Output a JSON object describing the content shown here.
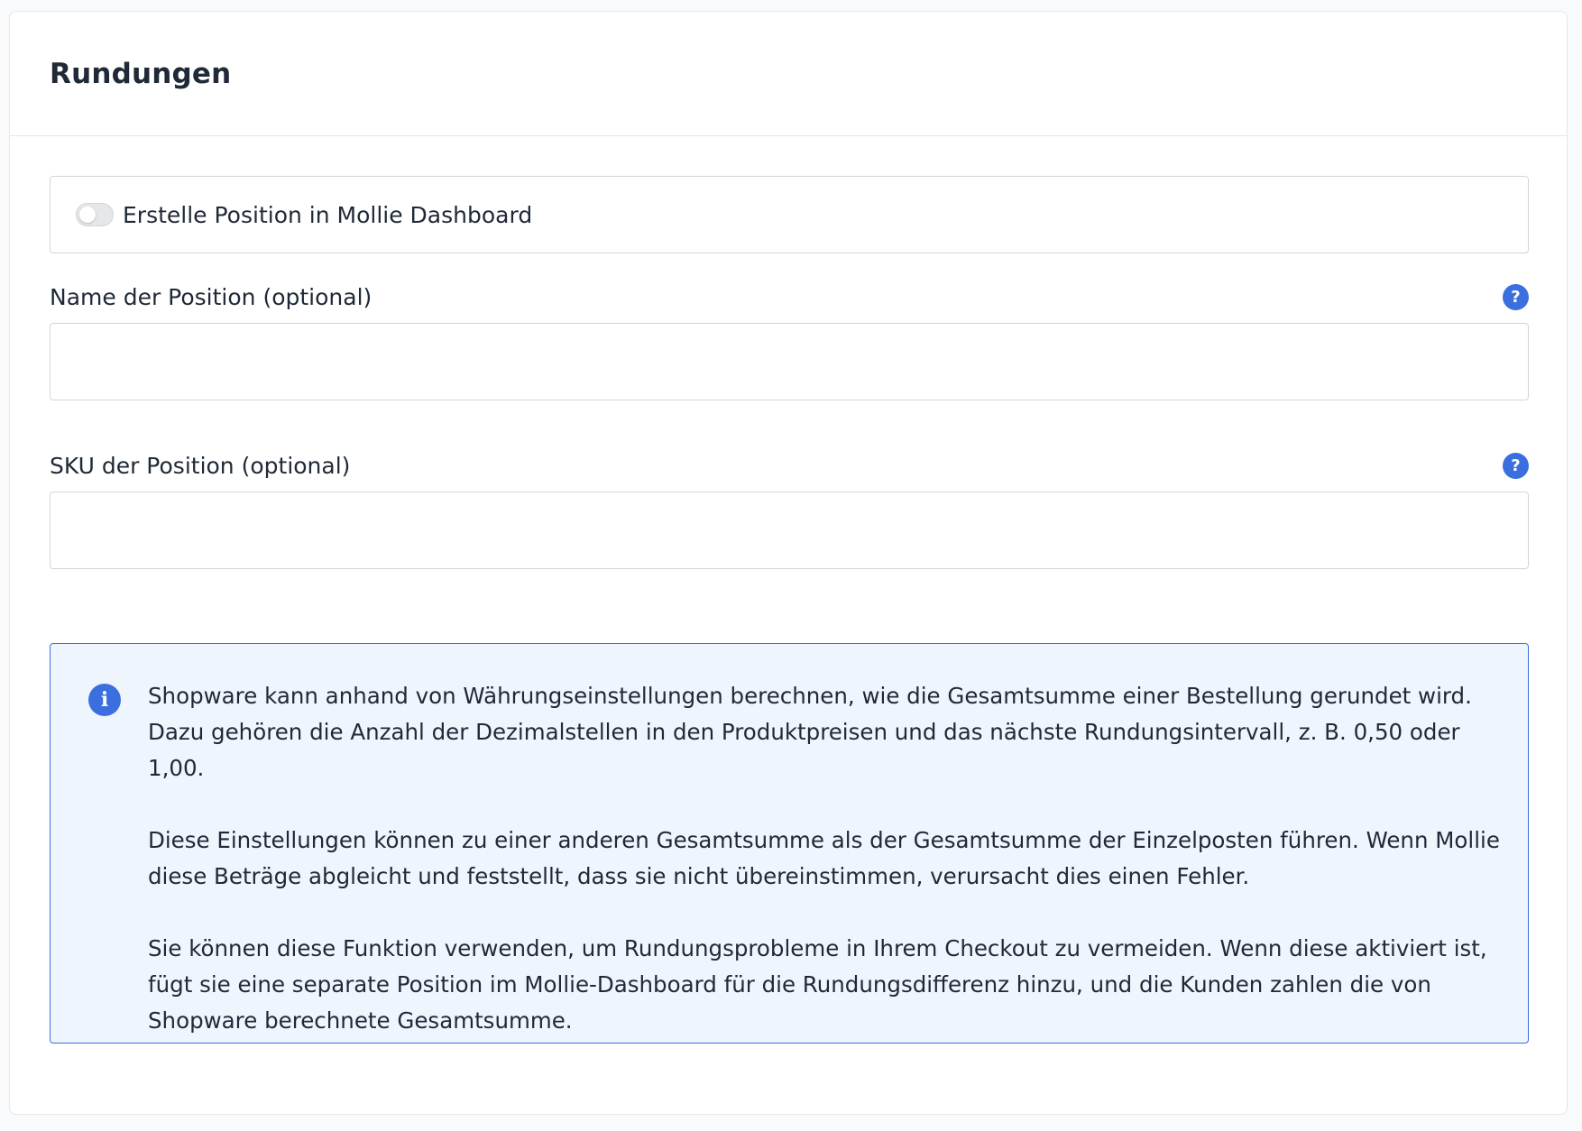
{
  "card": {
    "title": "Rundungen"
  },
  "toggle": {
    "label": "Erstelle Position in Mollie Dashboard",
    "enabled": false
  },
  "fields": {
    "name": {
      "label": "Name der Position (optional)",
      "value": "",
      "help_icon": "question-icon"
    },
    "sku": {
      "label": "SKU der Position (optional)",
      "value": "",
      "help_icon": "question-icon"
    }
  },
  "info": {
    "icon": "info-icon",
    "paragraphs": [
      "Shopware kann anhand von Währungseinstellungen berechnen, wie die Gesamtsumme einer Bestellung gerundet wird. Dazu gehören die Anzahl der Dezimalstellen in den Produktpreisen und das nächste Rundungsintervall, z. B. 0,50 oder 1,00.",
      "Diese Einstellungen können zu einer anderen Gesamtsumme als der Gesamtsumme der Einzelposten führen. Wenn Mollie diese Beträge abgleicht und feststellt, dass sie nicht übereinstimmen, verursacht dies einen Fehler.",
      "Sie können diese Funktion verwenden, um Rundungsprobleme in Ihrem Checkout zu vermeiden. Wenn diese aktiviert ist, fügt sie eine separate Position im Mollie-Dashboard für die Rundungsdifferenz hinzu, und die Kunden zahlen die von Shopware berechnete Gesamtsumme."
    ]
  },
  "colors": {
    "accent": "#3b6fe0",
    "info_background": "#eff5fd",
    "border": "#d1d5db"
  }
}
